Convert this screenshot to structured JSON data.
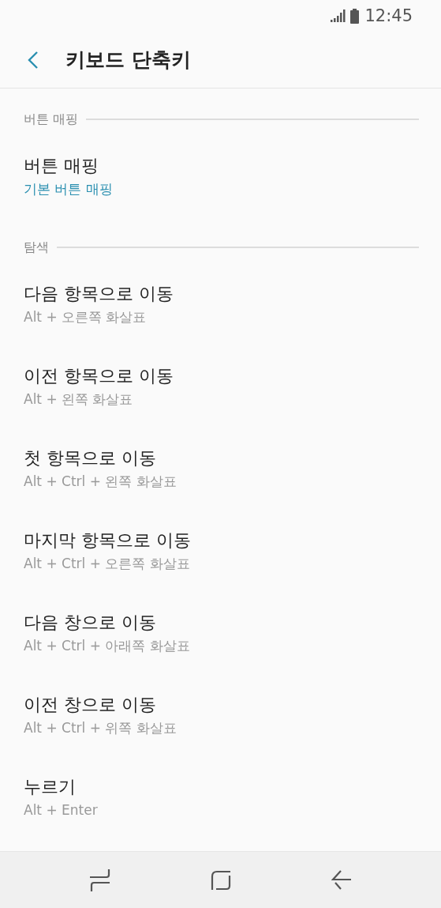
{
  "status_bar": {
    "time": "12:45"
  },
  "app_bar": {
    "title": "키보드 단축키"
  },
  "sections": [
    {
      "header": "버튼 매핑",
      "items": [
        {
          "title": "버튼 매핑",
          "summary": "기본 버튼 매핑",
          "kind": "value"
        }
      ]
    },
    {
      "header": "탐색",
      "items": [
        {
          "title": "다음 항목으로 이동",
          "summary": "Alt + 오른쪽 화살표",
          "kind": "shortcut"
        },
        {
          "title": "이전 항목으로 이동",
          "summary": "Alt + 왼쪽 화살표",
          "kind": "shortcut"
        },
        {
          "title": "첫 항목으로 이동",
          "summary": "Alt + Ctrl + 왼쪽 화살표",
          "kind": "shortcut"
        },
        {
          "title": "마지막 항목으로 이동",
          "summary": "Alt + Ctrl + 오른쪽 화살표",
          "kind": "shortcut"
        },
        {
          "title": "다음 창으로 이동",
          "summary": "Alt + Ctrl + 아래쪽 화살표",
          "kind": "shortcut"
        },
        {
          "title": "이전 창으로 이동",
          "summary": "Alt + Ctrl + 위쪽 화살표",
          "kind": "shortcut"
        },
        {
          "title": "누르기",
          "summary": "Alt + Enter",
          "kind": "shortcut"
        }
      ]
    }
  ]
}
